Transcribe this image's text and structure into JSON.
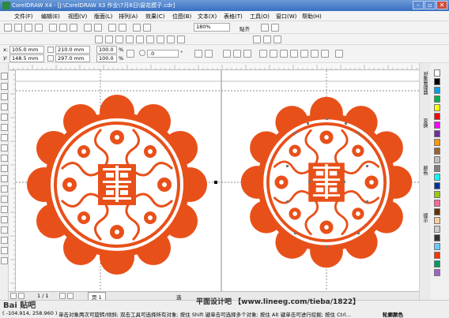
{
  "window": {
    "title": "CorelDRAW X4 - [J:\\CorelDRAW X3 作业\\7月8日\\窗花模子.cdr]"
  },
  "menu": {
    "items": [
      "文件(F)",
      "编辑(E)",
      "视图(V)",
      "版面(L)",
      "排列(A)",
      "效果(C)",
      "位图(B)",
      "文本(X)",
      "表格(T)",
      "工具(O)",
      "窗口(W)",
      "帮助(H)"
    ]
  },
  "toolbar": {
    "zoom": "180%",
    "snap": "贴齐"
  },
  "property_bar": {
    "x_label": "x:",
    "x": "105.0 mm",
    "y_label": "y:",
    "y": "148.5 mm",
    "w": "210.0 mm",
    "h": "297.0 mm",
    "scale_x": "100.0",
    "scale_y": "100.0",
    "pct": "%",
    "angle": ".0",
    "angle_unit": "°"
  },
  "page_tabs": {
    "counter": "1 / 1",
    "page": "页 1"
  },
  "status": {
    "coords": "( -104.914, 258.960 )",
    "message": "单击对象两次可旋转/倾斜; 双击工具可选择所有对象; 按住 Shift 键单击可选择多个对象; 按住 Alt 键单击可进行挖掘; 按住 Ctrl...",
    "sel": "选",
    "outline": "轮廓颜色"
  },
  "watermark": {
    "left": "Bai 贴吧",
    "right": "平面设计吧 【www.lineeg.com/tieba/1822】"
  },
  "colors": {
    "papercut": "#e8501a",
    "title_bar": "#3a6fc0"
  },
  "palette": [
    "#ffffff",
    "#000000",
    "#00a0e9",
    "#00b050",
    "#ffff00",
    "#ff0000",
    "#ff00ff",
    "#7030a0",
    "#ff9900",
    "#996633",
    "#c0c0c0",
    "#808080",
    "#00ffff",
    "#003399",
    "#99cc00",
    "#ff6699",
    "#663300",
    "#ffcc99",
    "#cccccc",
    "#333333",
    "#66ccff",
    "#ff3300",
    "#009966",
    "#9966cc"
  ],
  "docker_tabs": [
    "对象管理器",
    "变换",
    "颜色",
    "提示"
  ]
}
